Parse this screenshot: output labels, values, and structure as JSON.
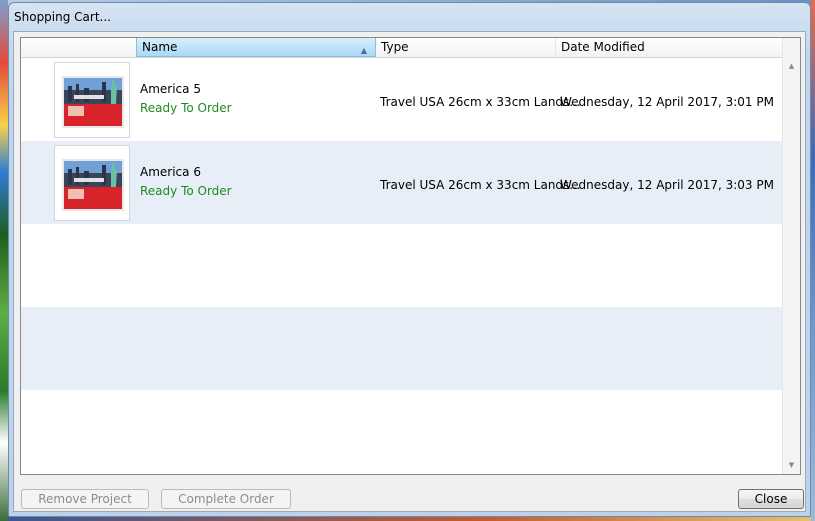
{
  "window": {
    "title": "Shopping Cart..."
  },
  "columns": [
    {
      "label": "Name",
      "sorted": true
    },
    {
      "label": "Type",
      "sorted": false
    },
    {
      "label": "Date Modified",
      "sorted": false
    }
  ],
  "rows": [
    {
      "name": "America 5",
      "status": "Ready To Order",
      "type": "Travel USA 26cm x 33cm Lands...",
      "date_modified": "Wednesday, 12 April 2017, 3:01 PM",
      "thumbnail_icon": "photo-book-thumbnail-icon"
    },
    {
      "name": "America 6",
      "status": "Ready To Order",
      "type": "Travel USA 26cm x 33cm Lands...",
      "date_modified": "Wednesday, 12 April 2017, 3:03 PM",
      "thumbnail_icon": "photo-book-thumbnail-icon"
    }
  ],
  "buttons": {
    "remove_project": "Remove Project",
    "complete_order": "Complete Order",
    "close": "Close"
  },
  "colors": {
    "status_green": "#1f8a1f",
    "selected_header": "#bfe4f8",
    "alt_row": "#e8eef8"
  }
}
